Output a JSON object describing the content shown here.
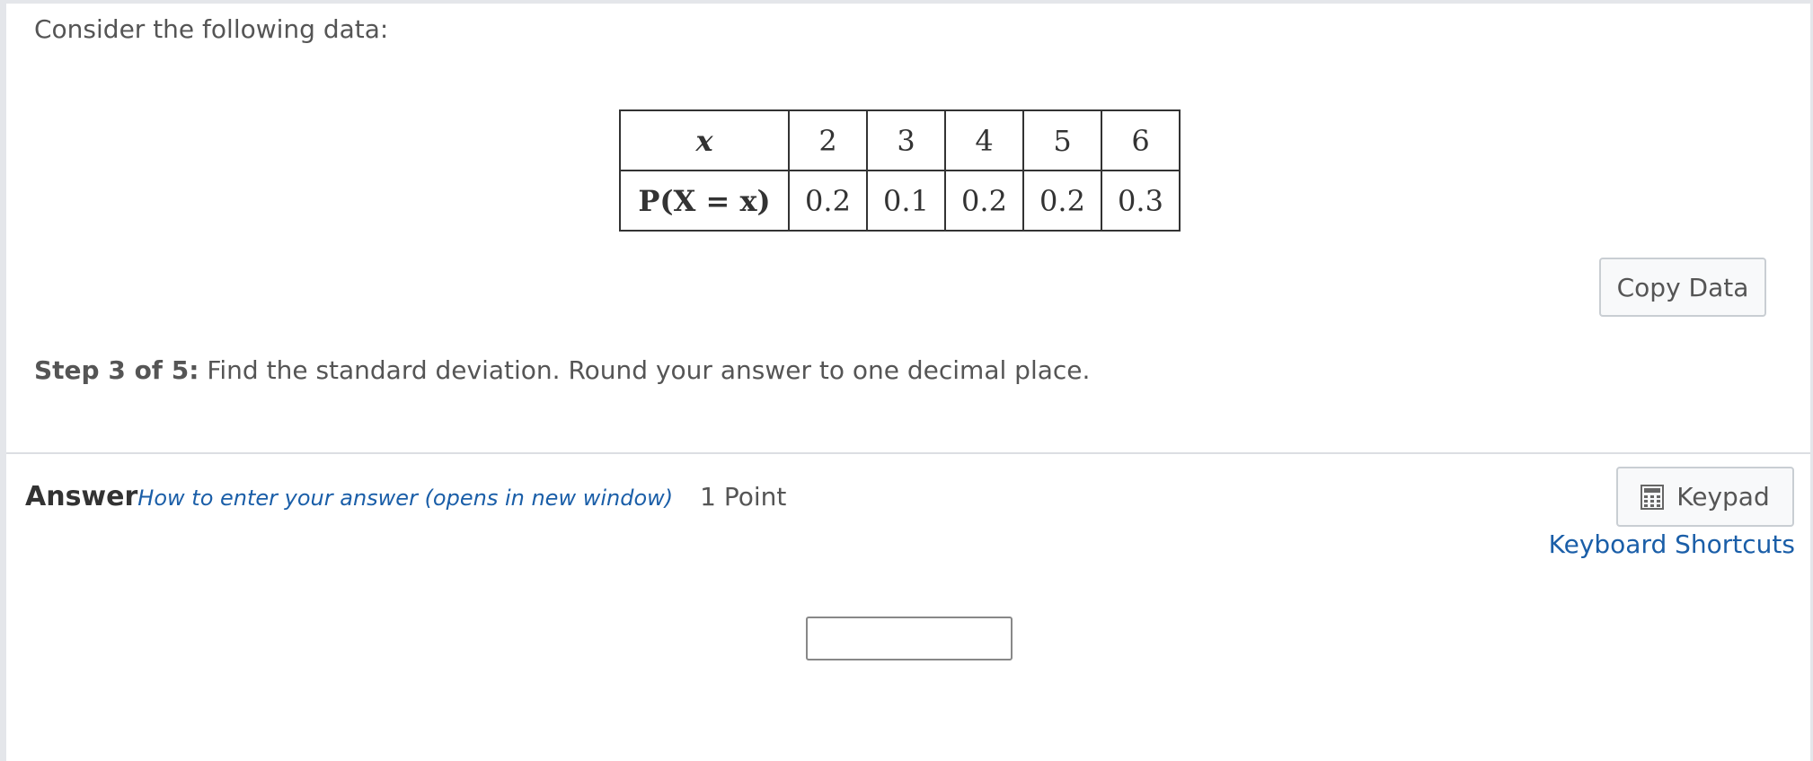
{
  "intro": "Consider the following data:",
  "table": {
    "x_label": "x",
    "p_label": "P(X = x)",
    "x_values": [
      "2",
      "3",
      "4",
      "5",
      "6"
    ],
    "p_values": [
      "0.2",
      "0.1",
      "0.2",
      "0.2",
      "0.3"
    ]
  },
  "copy_button": "Copy Data",
  "step": {
    "prefix": "Step 3 of 5:",
    "text": " Find the standard deviation. Round your answer to one decimal place."
  },
  "answer": {
    "label": "Answer",
    "howto_link": "How to enter your answer (opens in new window)",
    "points": "1 Point",
    "keypad_button": "Keypad",
    "shortcuts_link": "Keyboard Shortcuts",
    "input_value": ""
  },
  "icons": {
    "keypad": "calculator-icon"
  }
}
